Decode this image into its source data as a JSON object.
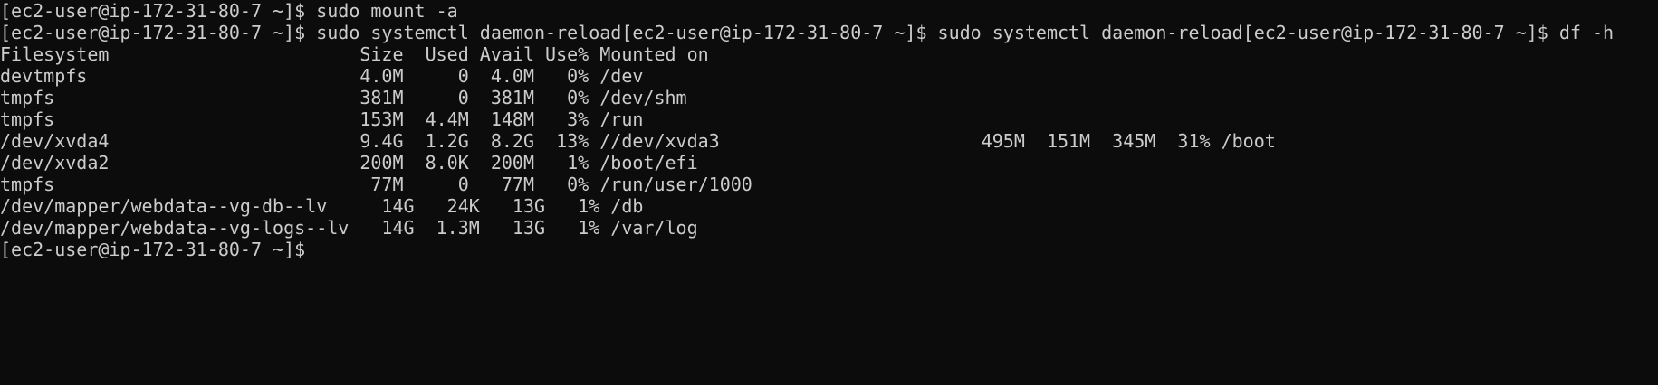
{
  "terminal": {
    "lines": [
      "[ec2-user@ip-172-31-80-7 ~]$ sudo mount -a",
      "[ec2-user@ip-172-31-80-7 ~]$ sudo systemctl daemon-reload[ec2-user@ip-172-31-80-7 ~]$ sudo systemctl daemon-reload[ec2-user@ip-172-31-80-7 ~]$ df -h",
      "Filesystem                       Size  Used Avail Use% Mounted on",
      "devtmpfs                         4.0M     0  4.0M   0% /dev",
      "tmpfs                            381M     0  381M   0% /dev/shm",
      "tmpfs                            153M  4.4M  148M   3% /run",
      "/dev/xvda4                       9.4G  1.2G  8.2G  13% //dev/xvda3                        495M  151M  345M  31% /boot",
      "/dev/xvda2                       200M  8.0K  200M   1% /boot/efi",
      "tmpfs                             77M     0   77M   0% /run/user/1000",
      "/dev/mapper/webdata--vg-db--lv     14G   24K   13G   1% /db",
      "/dev/mapper/webdata--vg-logs--lv   14G  1.3M   13G   1% /var/log",
      "[ec2-user@ip-172-31-80-7 ~]$"
    ]
  },
  "colors": {
    "background": "#0c0c0c",
    "foreground": "#cccccc"
  }
}
